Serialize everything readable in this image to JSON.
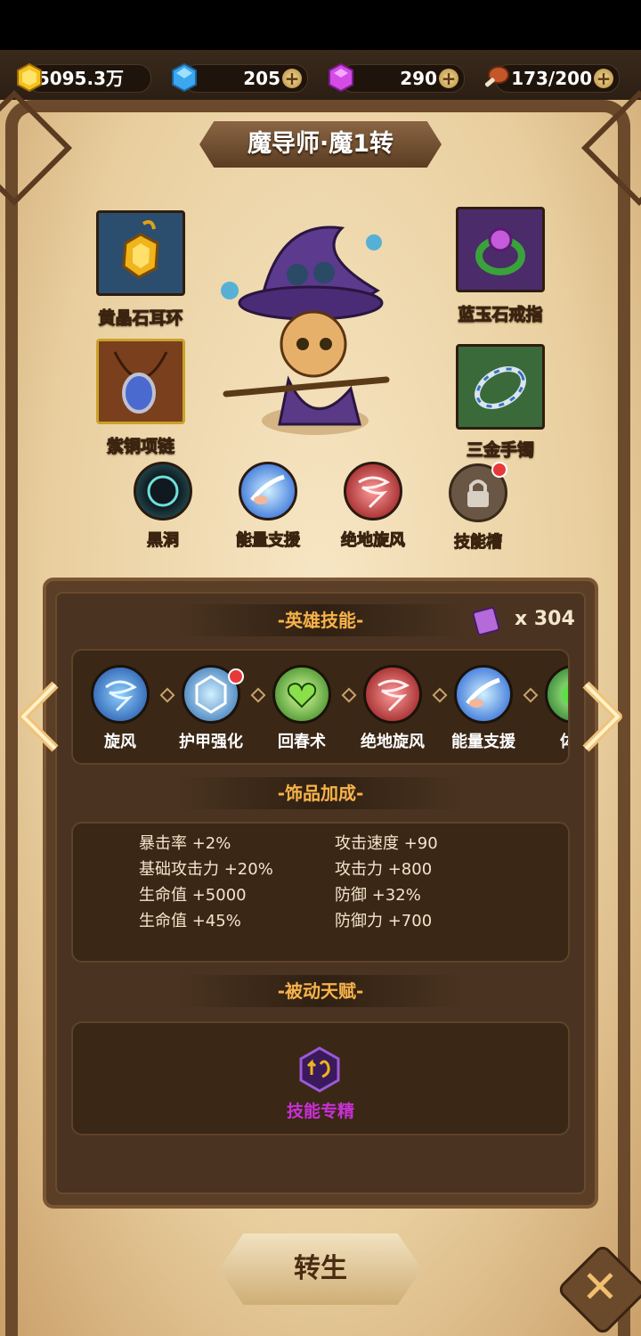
{
  "currencies": {
    "gold": {
      "value": "5095.3万",
      "icon": "gold-coin-icon"
    },
    "diamond": {
      "value": "205",
      "icon": "blue-diamond-icon"
    },
    "gem": {
      "value": "290",
      "icon": "purple-gem-icon"
    },
    "stamina": {
      "value": "173/200",
      "icon": "meat-icon"
    }
  },
  "hero_title": "魔导师·魔1转",
  "equipment": [
    {
      "name": "黄晶石耳环",
      "icon": "earring-icon"
    },
    {
      "name": "蓝玉石戒指",
      "icon": "ring-icon"
    },
    {
      "name": "紫铜项链",
      "icon": "necklace-icon"
    },
    {
      "name": "三金手镯",
      "icon": "bracelet-icon"
    }
  ],
  "equipped_skills": [
    {
      "name": "黑洞",
      "icon": "black-hole-icon"
    },
    {
      "name": "能量支援",
      "icon": "energy-support-icon"
    },
    {
      "name": "绝地旋风",
      "icon": "red-whirlwind-icon"
    },
    {
      "name": "技能槽",
      "icon": "lock-icon"
    }
  ],
  "hero_skills": {
    "title": "-英雄技能-",
    "book_count": "x 304",
    "skills": [
      {
        "name": "旋风",
        "icon": "whirlwind-icon"
      },
      {
        "name": "护甲强化",
        "icon": "armor-boost-icon"
      },
      {
        "name": "回春术",
        "icon": "heal-heart-icon"
      },
      {
        "name": "绝地旋风",
        "icon": "red-whirlwind-icon"
      },
      {
        "name": "能量支援",
        "icon": "energy-support-icon"
      },
      {
        "name": "体质",
        "icon": "constitution-icon"
      }
    ]
  },
  "accessory_bonus": {
    "title": "-饰品加成-",
    "left": [
      "暴击率 +2%",
      "基础攻击力 +20%",
      "生命值 +5000",
      "生命值 +45%"
    ],
    "right": [
      "攻击速度 +90",
      "攻击力 +800",
      "防御 +32%",
      "防御力 +700"
    ]
  },
  "passive": {
    "title": "-被动天赋-",
    "talent": "技能专精",
    "icon": "skill-mastery-icon"
  },
  "buttons": {
    "rebirth": "转生",
    "close": "✕"
  },
  "colors": {
    "section_title": "#f7b34a",
    "talent_text": "#c930d6",
    "badge": "#e63a3a"
  }
}
